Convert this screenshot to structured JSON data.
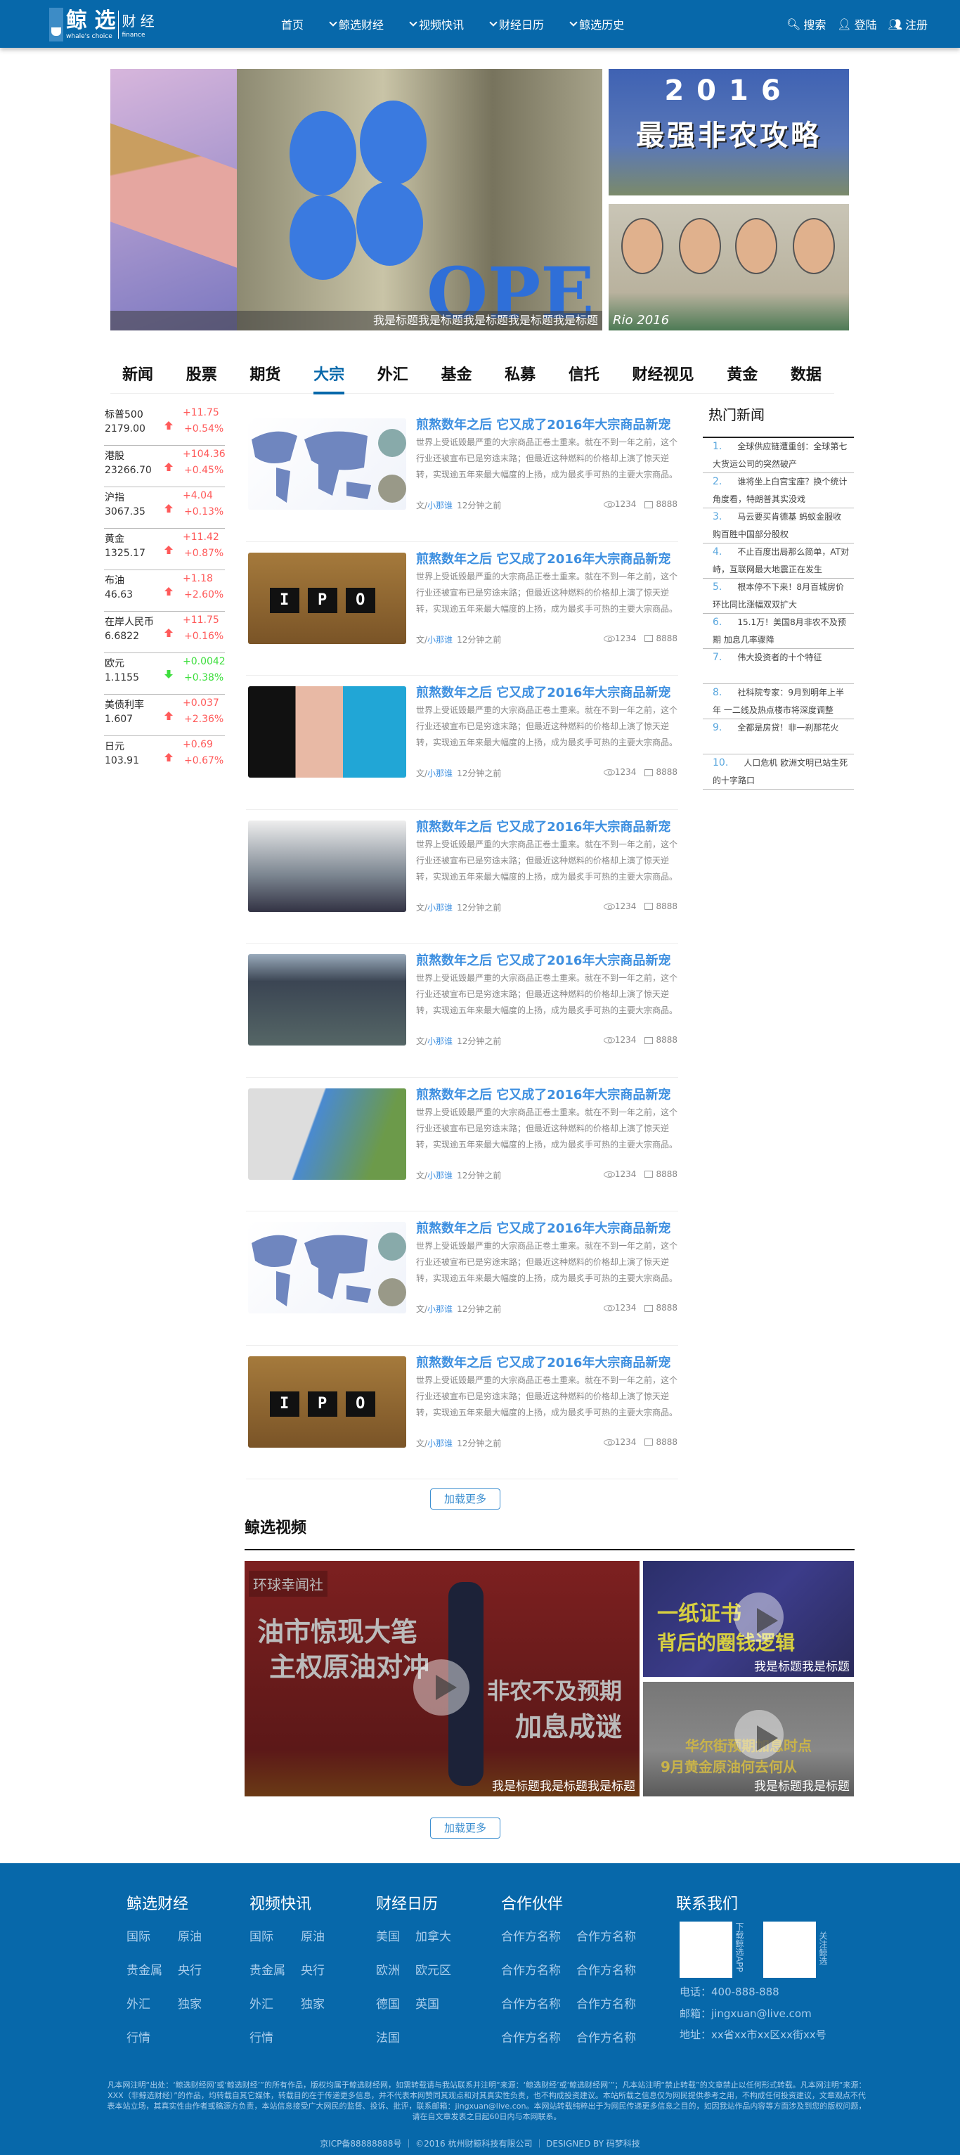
{
  "header": {
    "logo": {
      "main": "鲸 选",
      "side": "财 经",
      "sub": "whale's choice",
      "sub2": "finance"
    },
    "nav": [
      "首页",
      "鲸选财经",
      "视频快讯",
      "财经日历",
      "鲸选历史"
    ],
    "search": "搜索",
    "login": "登陆",
    "register": "注册",
    "brand_color": "#0768aa"
  },
  "banner": {
    "caption": "我是标题我是标题我是标题我是标题我是标题",
    "side1_year": "2016",
    "side1_title": "最强非农攻略",
    "side2_text": "Rio 2016"
  },
  "tabs": [
    "新闻",
    "股票",
    "期货",
    "大宗",
    "外汇",
    "基金",
    "私募",
    "信托",
    "财经视见",
    "黄金",
    "数据"
  ],
  "active_tab": "大宗",
  "ticker": [
    {
      "name": "标普500",
      "price": "2179.00",
      "change": "+11.75",
      "pct": "+0.54%",
      "dir": "up"
    },
    {
      "name": "港股",
      "price": "23266.70",
      "change": "+104.36",
      "pct": "+0.45%",
      "dir": "up"
    },
    {
      "name": "沪指",
      "price": "3067.35",
      "change": "+4.04",
      "pct": "+0.13%",
      "dir": "up"
    },
    {
      "name": "黄金",
      "price": "1325.17",
      "change": "+11.42",
      "pct": "+0.87%",
      "dir": "up"
    },
    {
      "name": "布油",
      "price": "46.63",
      "change": "+1.18",
      "pct": "+2.60%",
      "dir": "up"
    },
    {
      "name": "在岸人民币",
      "price": "6.6822",
      "change": "+11.75",
      "pct": "+0.16%",
      "dir": "up"
    },
    {
      "name": "欧元",
      "price": "1.1155",
      "change": "+0.0042",
      "pct": "+0.38%",
      "dir": "down"
    },
    {
      "name": "美债利率",
      "price": "1.607",
      "change": "+0.037",
      "pct": "+2.36%",
      "dir": "up"
    },
    {
      "name": "日元",
      "price": "103.91",
      "change": "+0.69",
      "pct": "+0.67%",
      "dir": "up"
    }
  ],
  "articles": [
    {
      "img": "map"
    },
    {
      "img": "ipo"
    },
    {
      "img": "comic"
    },
    {
      "img": "web"
    },
    {
      "img": "dash"
    },
    {
      "img": "van"
    },
    {
      "img": "map"
    },
    {
      "img": "ipo"
    }
  ],
  "article_common": {
    "title": "煎熬数年之后 它又成了2016年大宗商品新宠",
    "summary": "世界上受诋毁最严重的大宗商品正卷土重来。就在不到一年之前，这个行业还被宣布已是穷途末路；但最近这种燃料的价格却上演了惊天逆转，实现逾五年来最大幅度的上扬，成为最炙手可热的主要大宗商品。",
    "author_prefix": "文/",
    "author": "小那谁",
    "time": "12分钟之前",
    "views": "1234",
    "comments": "8888",
    "ipo_text": "IPO"
  },
  "hot_news": {
    "title": "热门新闻",
    "items": [
      {
        "num": "1.",
        "text": "全球供应链遭重创：全球第七大货运公司的突然破产"
      },
      {
        "num": "2.",
        "text": "谁将坐上白宫宝座？换个统计角度看，特朗普其实没戏"
      },
      {
        "num": "3.",
        "text": "马云要买肯德基 蚂蚁金服收购百胜中国部分股权"
      },
      {
        "num": "4.",
        "text": "不止百度出局那么简单，AT对峙，互联网最大地震正在发生"
      },
      {
        "num": "5.",
        "text": "根本停不下来！8月百城房价环比同比涨幅双双扩大"
      },
      {
        "num": "6.",
        "text": "15.1万！美国8月非农不及预期 加息几率骤降"
      },
      {
        "num": "7.",
        "text": "伟大投资者的十个特征"
      },
      {
        "num": "8.",
        "text": "社科院专家：9月到明年上半年 一二线及热点楼市将深度调整"
      },
      {
        "num": "9.",
        "text": "全都是房贷！非一刹那花火"
      },
      {
        "num": "10.",
        "text": "人口危机 欧洲文明已站生死 的十字路口"
      }
    ]
  },
  "load_more": "加载更多",
  "video": {
    "title": "鲸选视频",
    "big": {
      "caption": "我是标题我是标题我是标题",
      "brand": "环球幸闻社",
      "line1": "油市惊现大笔",
      "line2": "主权原油对冲",
      "line3": "非农不及预期",
      "line4": "加息成谜"
    },
    "small1": {
      "caption": "我是标题我是标题",
      "line1": "一纸证书",
      "line2": "背后的圈钱逻辑"
    },
    "small2": {
      "caption": "我是标题我是标题",
      "line1": "华尔街预期加息时点",
      "line2": "9月黄金原油何去何从"
    }
  },
  "footer": {
    "cols": [
      {
        "title": "鲸选财经",
        "links": [
          "国际",
          "原油",
          "贵金属",
          "央行",
          "外汇",
          "独家",
          "行情"
        ]
      },
      {
        "title": "视频快讯",
        "links": [
          "国际",
          "原油",
          "贵金属",
          "央行",
          "外汇",
          "独家",
          "行情"
        ]
      },
      {
        "title": "财经日历",
        "links": [
          "美国",
          "加拿大",
          "欧洲",
          "欧元区",
          "德国",
          "英国",
          "法国"
        ]
      },
      {
        "title": "合作伙伴",
        "links": [
          "合作方名称",
          "合作方名称",
          "合作方名称",
          "合作方名称",
          "合作方名称",
          "合作方名称",
          "合作方名称",
          "合作方名称"
        ]
      }
    ],
    "contact": {
      "title": "联系我们",
      "qr1_label": "下载鲸选APP",
      "qr2_label": "关注鲸选",
      "phone": "电话：400-888-888",
      "email": "邮箱：jingxuan@live.com",
      "address": "地址：xx省xx市xx区xx街xx号"
    },
    "legal": "凡本网注明“出处：‘鲸选财经网’或‘鲸选财经’”的所有作品，版权均属于鲸选财经网，如需转载请与我站联系并注明“来源：‘鲸选财经’或‘鲸选财经网’”；凡本站注明“禁止转载”的文章禁止以任何形式转载。凡本网注明“来源：XXX（非鲸选财经）”的作品，均转载自其它媒体，转载目的在于传递更多信息，并不代表本网赞同其观点和对其真实性负责，也不构成投资建议。本站所载之信息仅为网民提供参考之用，不构成任何投资建议，文章观点不代表本站立场，其真实性由作者或稿源方负责，本站信息接受广大网民的监督、投诉、批评，联系邮箱：jingxuan@live.con。本网站转载纯粹出于为网民传递更多信息之目的，如因我站作品内容等方面涉及到您的版权问题，请在自文章发表之日起60日内与本网联系。",
    "copyright": "京ICP备88888888号 ｜ ©2016 杭州财鲸科技有限公司 ｜ DESIGNED BY 码梦科技"
  }
}
